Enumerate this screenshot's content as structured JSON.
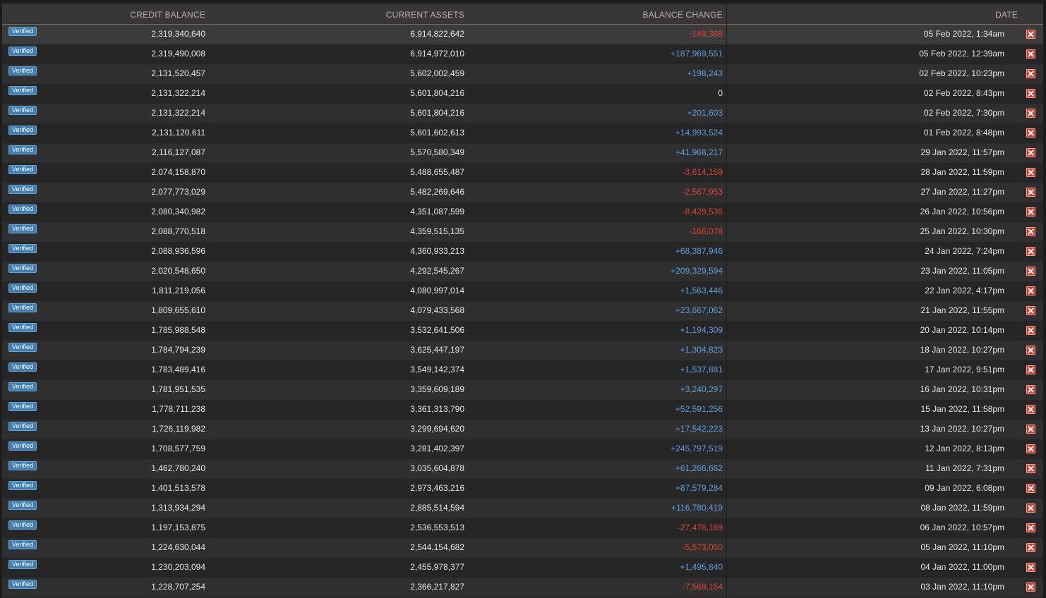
{
  "table": {
    "headers": {
      "credit_balance": "CREDIT BALANCE",
      "current_assets": "CURRENT ASSETS",
      "balance_change": "BALANCE CHANGE",
      "date": "DATE"
    },
    "colors": {
      "positive": "#5b9ee0",
      "negative": "#e0432f",
      "badge": "#3f7eb3",
      "delete": "#d53b2c"
    },
    "rows": [
      {
        "badge": "Verified",
        "credit": "2,319,340,640",
        "assets": "6,914,822,642",
        "change": "-149,368",
        "date": "05 Feb 2022, 1:34am"
      },
      {
        "badge": "Verified",
        "credit": "2,319,490,008",
        "assets": "6,914,972,010",
        "change": "+187,969,551",
        "date": "05 Feb 2022, 12:39am"
      },
      {
        "badge": "Verified",
        "credit": "2,131,520,457",
        "assets": "5,602,002,459",
        "change": "+198,243",
        "date": "02 Feb 2022, 10:23pm"
      },
      {
        "badge": "Verified",
        "credit": "2,131,322,214",
        "assets": "5,601,804,216",
        "change": "0",
        "date": "02 Feb 2022, 8:43pm"
      },
      {
        "badge": "Verified",
        "credit": "2,131,322,214",
        "assets": "5,601,804,216",
        "change": "+201,603",
        "date": "02 Feb 2022, 7:30pm"
      },
      {
        "badge": "Verified",
        "credit": "2,131,120,611",
        "assets": "5,601,602,613",
        "change": "+14,993,524",
        "date": "01 Feb 2022, 8:48pm"
      },
      {
        "badge": "Verified",
        "credit": "2,116,127,087",
        "assets": "5,570,580,349",
        "change": "+41,968,217",
        "date": "29 Jan 2022, 11:57pm"
      },
      {
        "badge": "Verified",
        "credit": "2,074,158,870",
        "assets": "5,488,655,487",
        "change": "-3,614,159",
        "date": "28 Jan 2022, 11:59pm"
      },
      {
        "badge": "Verified",
        "credit": "2,077,773,029",
        "assets": "5,482,269,646",
        "change": "-2,567,953",
        "date": "27 Jan 2022, 11:27pm"
      },
      {
        "badge": "Verified",
        "credit": "2,080,340,982",
        "assets": "4,351,087,599",
        "change": "-8,429,536",
        "date": "26 Jan 2022, 10:56pm"
      },
      {
        "badge": "Verified",
        "credit": "2,088,770,518",
        "assets": "4,359,515,135",
        "change": "-166,078",
        "date": "25 Jan 2022, 10:30pm"
      },
      {
        "badge": "Verified",
        "credit": "2,088,936,596",
        "assets": "4,360,933,213",
        "change": "+68,387,946",
        "date": "24 Jan 2022, 7:24pm"
      },
      {
        "badge": "Verified",
        "credit": "2,020,548,650",
        "assets": "4,292,545,267",
        "change": "+209,329,594",
        "date": "23 Jan 2022, 11:05pm"
      },
      {
        "badge": "Verified",
        "credit": "1,811,219,056",
        "assets": "4,080,997,014",
        "change": "+1,563,446",
        "date": "22 Jan 2022, 4:17pm"
      },
      {
        "badge": "Verified",
        "credit": "1,809,655,610",
        "assets": "4,079,433,568",
        "change": "+23,667,062",
        "date": "21 Jan 2022, 11:55pm"
      },
      {
        "badge": "Verified",
        "credit": "1,785,988,548",
        "assets": "3,532,641,506",
        "change": "+1,194,309",
        "date": "20 Jan 2022, 10:14pm"
      },
      {
        "badge": "Verified",
        "credit": "1,784,794,239",
        "assets": "3,625,447,197",
        "change": "+1,304,823",
        "date": "18 Jan 2022, 10:27pm"
      },
      {
        "badge": "Verified",
        "credit": "1,783,489,416",
        "assets": "3,549,142,374",
        "change": "+1,537,881",
        "date": "17 Jan 2022, 9:51pm"
      },
      {
        "badge": "Verified",
        "credit": "1,781,951,535",
        "assets": "3,359,609,189",
        "change": "+3,240,297",
        "date": "16 Jan 2022, 10:31pm"
      },
      {
        "badge": "Verified",
        "credit": "1,778,711,238",
        "assets": "3,361,313,790",
        "change": "+52,591,256",
        "date": "15 Jan 2022, 11:58pm"
      },
      {
        "badge": "Verified",
        "credit": "1,726,119,982",
        "assets": "3,299,694,620",
        "change": "+17,542,223",
        "date": "13 Jan 2022, 10:27pm"
      },
      {
        "badge": "Verified",
        "credit": "1,708,577,759",
        "assets": "3,281,402,397",
        "change": "+245,797,519",
        "date": "12 Jan 2022, 8:13pm"
      },
      {
        "badge": "Verified",
        "credit": "1,462,780,240",
        "assets": "3,035,604,878",
        "change": "+61,266,662",
        "date": "11 Jan 2022, 7:31pm"
      },
      {
        "badge": "Verified",
        "credit": "1,401,513,578",
        "assets": "2,973,463,216",
        "change": "+87,579,284",
        "date": "09 Jan 2022, 6:08pm"
      },
      {
        "badge": "Verified",
        "credit": "1,313,934,294",
        "assets": "2,885,514,594",
        "change": "+116,780,419",
        "date": "08 Jan 2022, 11:59pm"
      },
      {
        "badge": "Verified",
        "credit": "1,197,153,875",
        "assets": "2,536,553,513",
        "change": "-27,476,169",
        "date": "06 Jan 2022, 10:57pm"
      },
      {
        "badge": "Verified",
        "credit": "1,224,630,044",
        "assets": "2,544,154,682",
        "change": "-5,573,050",
        "date": "05 Jan 2022, 11:10pm"
      },
      {
        "badge": "Verified",
        "credit": "1,230,203,094",
        "assets": "2,455,978,377",
        "change": "+1,495,840",
        "date": "04 Jan 2022, 11:00pm"
      },
      {
        "badge": "Verified",
        "credit": "1,228,707,254",
        "assets": "2,366,217,827",
        "change": "-7,569,154",
        "date": "03 Jan 2022, 11:10pm"
      }
    ]
  }
}
